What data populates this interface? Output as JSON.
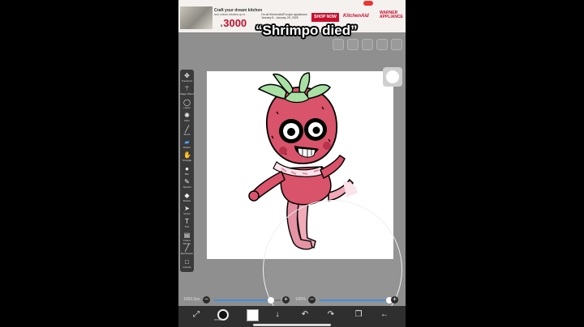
{
  "ad": {
    "headline": "Craft your dream kitchen",
    "subline": "and unlock rebates up to",
    "amount_prefix": "$",
    "amount": "3000",
    "offer": "On all KitchenAid® major appliances",
    "offer_dates": "January 8 - January 25, 2025",
    "cta": "SHOP NOW",
    "brand": "KitchenAid",
    "retailer": "WARNER APPLIANCE"
  },
  "caption": "“Shrimpo died”",
  "tools": [
    {
      "label": "Transform",
      "icon": "move-icon",
      "glyph": "✥"
    },
    {
      "label": "Magic Wand",
      "icon": "magic-wand-icon",
      "glyph": "⚚"
    },
    {
      "label": "Lasso",
      "icon": "lasso-icon",
      "glyph": "◯"
    },
    {
      "label": "Filter",
      "icon": "filter-icon",
      "glyph": "✺"
    },
    {
      "label": "Brush",
      "icon": "brush-icon",
      "glyph": "╱"
    },
    {
      "label": "Eraser",
      "icon": "eraser-icon",
      "glyph": "▰"
    },
    {
      "label": "Smudge",
      "icon": "smudge-icon",
      "glyph": "✋"
    },
    {
      "label": "Blur",
      "icon": "blur-icon",
      "glyph": "●"
    },
    {
      "label": "Special",
      "icon": "special-brush-icon",
      "glyph": "✎"
    },
    {
      "label": "Bucket",
      "icon": "bucket-icon",
      "glyph": "◆"
    },
    {
      "label": "Vector",
      "icon": "vector-icon",
      "glyph": "➤"
    },
    {
      "label": "Text",
      "icon": "text-icon",
      "glyph": "T"
    },
    {
      "label": "Frame Divider",
      "icon": "frame-divider-icon",
      "glyph": "▤"
    },
    {
      "label": "Eyedropper",
      "icon": "eyedropper-icon",
      "glyph": "╱"
    },
    {
      "label": "Canvas",
      "icon": "canvas-icon",
      "glyph": "□"
    }
  ],
  "active_tool": "Eraser",
  "sliders": {
    "size_value": "1000.0px",
    "size_fraction": 0.85,
    "opacity_value": "100%",
    "opacity_fraction": 1.0
  },
  "bottom": {
    "color_label": "0000000",
    "swatch_color": "#111111",
    "buttons": [
      "transform-arrows-icon",
      "download-arrow-icon",
      "undo-icon",
      "redo-icon",
      "layers-icon",
      "back-arrow-icon"
    ]
  },
  "colors": {
    "accent": "#3f8fe0",
    "strawberry": "#d9536a",
    "leaves": "#a8e0a4"
  }
}
